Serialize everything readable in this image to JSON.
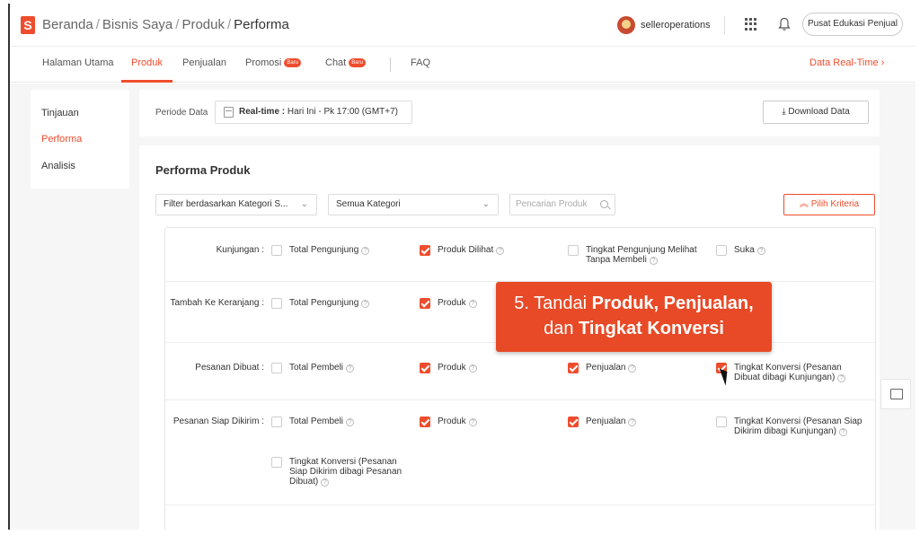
{
  "breadcrumb": {
    "items": [
      "Beranda",
      "Bisnis Saya",
      "Produk"
    ],
    "current": "Performa"
  },
  "header": {
    "username": "selleroperations",
    "edu_button": "Pusat Edukasi Penjual"
  },
  "tabs": [
    {
      "label": "Halaman Utama"
    },
    {
      "label": "Produk",
      "active": true
    },
    {
      "label": "Penjualan"
    },
    {
      "label": "Promosi",
      "badge": "Baru"
    },
    {
      "label": "Chat",
      "badge": "Baru"
    },
    {
      "label": "FAQ"
    }
  ],
  "realtime_link": "Data Real-Time",
  "sidebar": {
    "items": [
      {
        "label": "Tinjauan"
      },
      {
        "label": "Performa",
        "active": true
      },
      {
        "label": "Analisis"
      }
    ]
  },
  "period": {
    "label": "Periode Data",
    "mode": "Real-time :",
    "value": "Hari Ini - Pk 17:00 (GMT+7)",
    "download_label": "Download Data"
  },
  "performance": {
    "title": "Performa Produk",
    "filter_category_type": "Filter berdasarkan Kategori S...",
    "filter_category": "Semua Kategori",
    "search_placeholder": "Pencarian Produk",
    "criteria_button": "Pilih Kriteria"
  },
  "criteria": {
    "rows": [
      {
        "label": "Kunjungan :",
        "options": [
          {
            "label": "Total Pengunjung",
            "checked": false
          },
          {
            "label": "Produk Dilihat",
            "checked": true
          },
          {
            "label": "Tingkat Pengunjung Melihat Tanpa Membeli",
            "checked": false
          },
          {
            "label": "Suka",
            "checked": false
          }
        ]
      },
      {
        "label": "Tambah Ke Keranjang :",
        "options": [
          {
            "label": "Total Pengunjung",
            "checked": false
          },
          {
            "label": "Produk",
            "checked": true
          }
        ]
      },
      {
        "label": "Pesanan Dibuat :",
        "options": [
          {
            "label": "Total Pembeli",
            "checked": false
          },
          {
            "label": "Produk",
            "checked": true
          },
          {
            "label": "Penjualan",
            "checked": true
          },
          {
            "label": "Tingkat Konversi (Pesanan Dibuat dibagi Kunjungan)",
            "checked": true
          }
        ]
      },
      {
        "label": "Pesanan Siap Dikirim :",
        "options": [
          {
            "label": "Total Pembeli",
            "checked": false
          },
          {
            "label": "Produk",
            "checked": true
          },
          {
            "label": "Penjualan",
            "checked": true
          },
          {
            "label": "Tingkat Konversi (Pesanan Siap Dikirim dibagi Kunjungan)",
            "checked": false
          },
          {
            "label": "Tingkat Konversi (Pesanan Siap Dikirim dibagi Pesanan Dibuat)",
            "checked": false
          }
        ]
      }
    ]
  },
  "callout": {
    "prefix": "5. Tandai ",
    "bold1": "Produk, Penjualan,",
    "middle": "dan ",
    "bold2": "Tingkat Konversi"
  },
  "colors": {
    "accent": "#ee4d2d",
    "callout_bg": "#e84a27"
  },
  "icons": {
    "logo": "shopee-bag-icon",
    "apps": "grid-icon",
    "notification": "bell-icon",
    "calendar": "calendar-icon",
    "download": "download-icon",
    "search": "search-icon",
    "criteria": "chevron-up-double-icon",
    "help": "question-circle-icon"
  }
}
